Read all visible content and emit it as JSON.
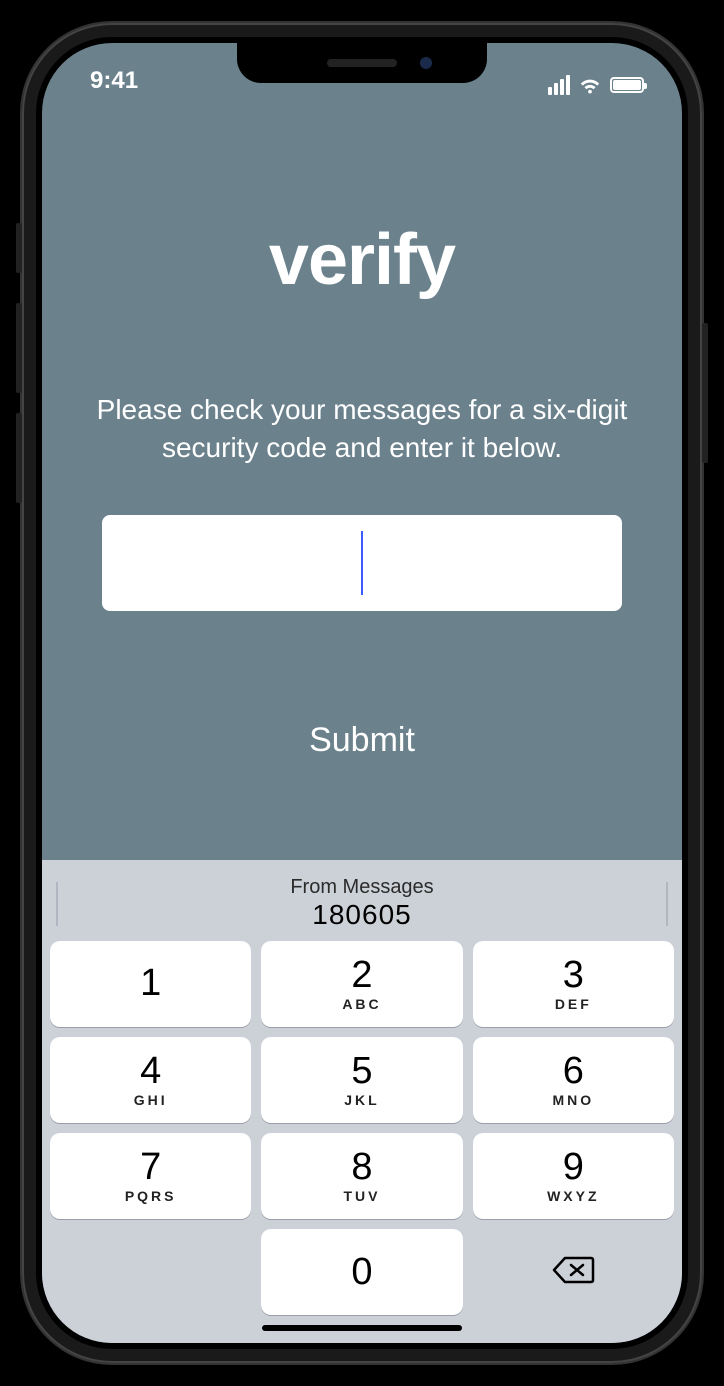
{
  "status": {
    "time": "9:41"
  },
  "screen": {
    "title": "verify",
    "instruction": "Please check your messages for a six-digit security code and enter it below.",
    "code_value": "",
    "submit_label": "Submit"
  },
  "autofill": {
    "label": "From Messages",
    "code": "180605"
  },
  "keypad": {
    "keys": [
      {
        "digit": "1",
        "letters": ""
      },
      {
        "digit": "2",
        "letters": "ABC"
      },
      {
        "digit": "3",
        "letters": "DEF"
      },
      {
        "digit": "4",
        "letters": "GHI"
      },
      {
        "digit": "5",
        "letters": "JKL"
      },
      {
        "digit": "6",
        "letters": "MNO"
      },
      {
        "digit": "7",
        "letters": "PQRS"
      },
      {
        "digit": "8",
        "letters": "TUV"
      },
      {
        "digit": "9",
        "letters": "WXYZ"
      },
      {
        "digit": "",
        "letters": ""
      },
      {
        "digit": "0",
        "letters": ""
      },
      {
        "digit": "",
        "letters": ""
      }
    ]
  }
}
